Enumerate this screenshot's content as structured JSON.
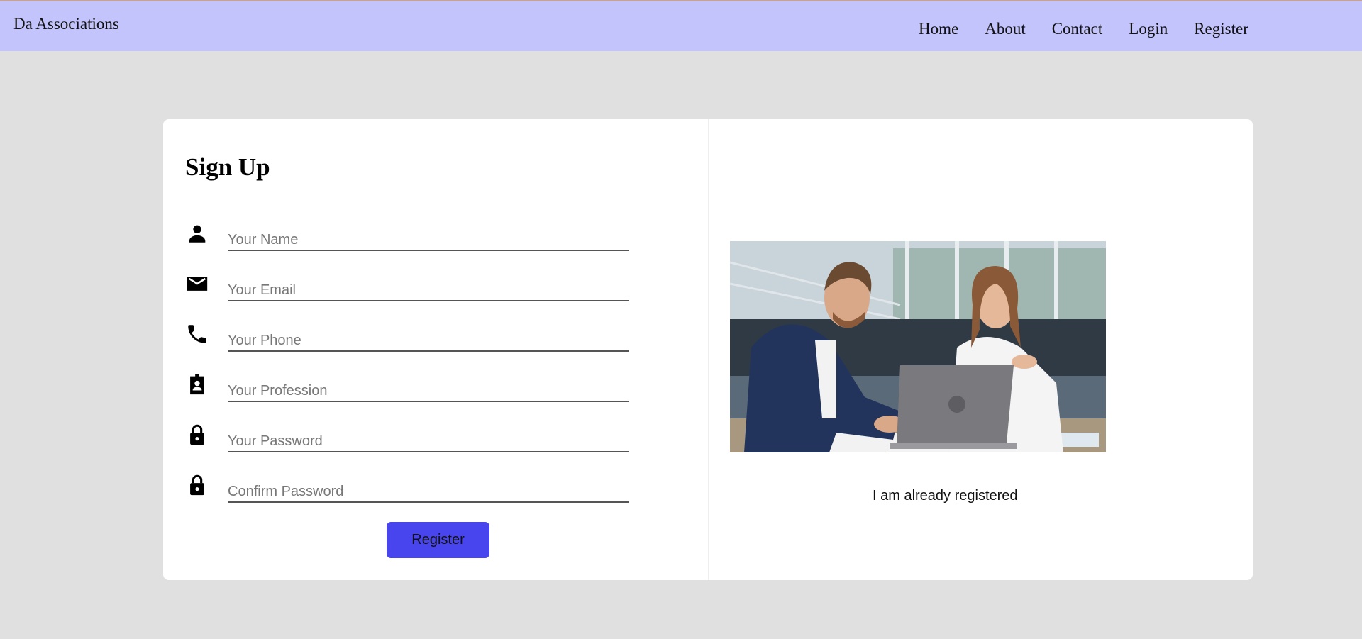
{
  "nav": {
    "brand": "Da Associations",
    "links": [
      "Home",
      "About",
      "Contact",
      "Login",
      "Register"
    ]
  },
  "form": {
    "title": "Sign Up",
    "fields": [
      {
        "placeholder": "Your Name",
        "icon": "person-icon"
      },
      {
        "placeholder": "Your Email",
        "icon": "mail-icon"
      },
      {
        "placeholder": "Your Phone",
        "icon": "phone-icon"
      },
      {
        "placeholder": "Your Profession",
        "icon": "badge-icon"
      },
      {
        "placeholder": "Your Password",
        "icon": "lock-icon"
      },
      {
        "placeholder": "Confirm Password",
        "icon": "lock-icon"
      }
    ],
    "submit_label": "Register"
  },
  "side": {
    "image_alt": "two colleagues working at a laptop in an office",
    "already_label": "I am already registered"
  },
  "colors": {
    "navbar_bg": "#c4c4fc",
    "page_bg": "#e0e0e0",
    "button_bg": "#4845ee"
  }
}
